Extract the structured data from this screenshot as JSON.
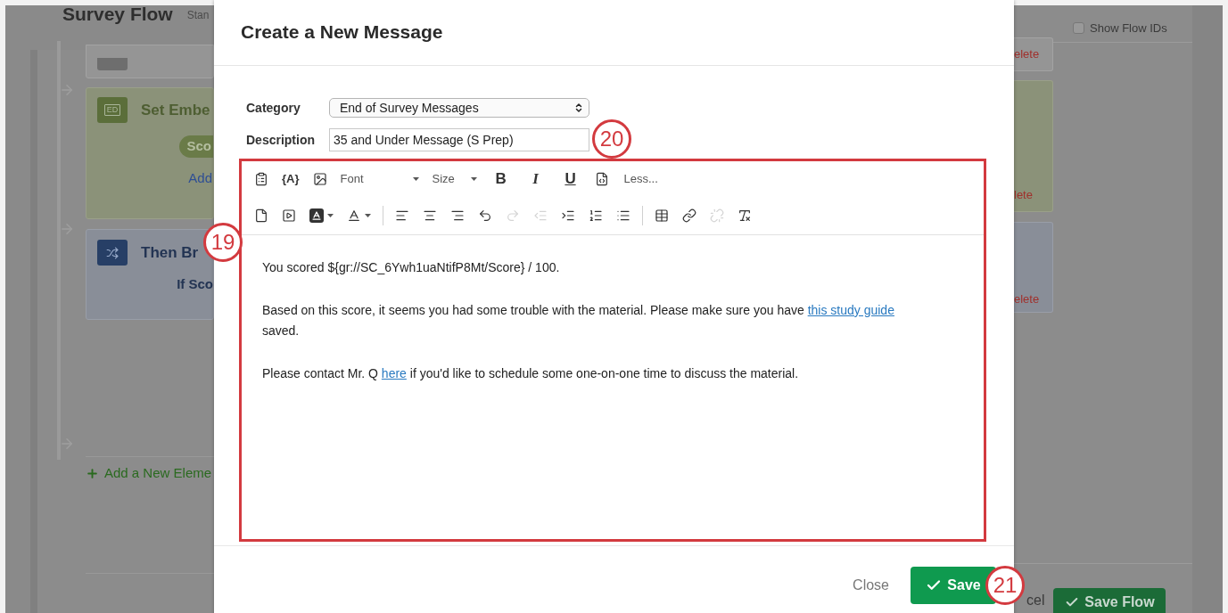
{
  "background": {
    "title": "Survey Flow",
    "subtitle": "Stan",
    "show_flow_ids": {
      "label": "Show Flow IDs",
      "checked": false
    },
    "flow_elements": [
      {
        "kind": "block",
        "delete": "elete"
      },
      {
        "kind": "embedded",
        "badge": "ED",
        "title": "Set Embe",
        "pill": "Sco",
        "link": "Add",
        "delete": "lete"
      },
      {
        "kind": "branch",
        "title": "Then Br",
        "condition": "If Sco",
        "delete": "elete"
      }
    ],
    "add_element": "Add a New Eleme",
    "cancel": "cel",
    "save_flow": "Save Flow"
  },
  "dialog": {
    "title": "Create a New Message",
    "category": {
      "label": "Category",
      "value": "End of Survey Messages"
    },
    "description": {
      "label": "Description",
      "value": "35 and Under Message (S Prep)",
      "marker": "20"
    },
    "editor": {
      "marker": "19",
      "toolbar_rows": [
        [
          {
            "kind": "icon",
            "disabled": false
          },
          {
            "kind": "glyph",
            "text": "{A}"
          },
          {
            "kind": "icon",
            "disabled": false
          },
          {
            "kind": "dropdown",
            "text": "Font"
          },
          {
            "kind": "dropdown",
            "text": "Size"
          },
          {
            "kind": "format",
            "text": "B"
          },
          {
            "kind": "format",
            "text": "I"
          },
          {
            "kind": "format",
            "text": "U"
          },
          {
            "kind": "icon",
            "disabled": false
          },
          {
            "kind": "link",
            "text": "Less..."
          }
        ],
        [
          {
            "kind": "icon",
            "disabled": false
          },
          {
            "kind": "icon",
            "disabled": false
          },
          {
            "kind": "icon_menu",
            "disabled": false
          },
          {
            "kind": "icon_menu",
            "disabled": false
          },
          {
            "kind": "separator"
          },
          {
            "kind": "icon",
            "disabled": false
          },
          {
            "kind": "icon",
            "disabled": false
          },
          {
            "kind": "icon",
            "disabled": false
          },
          {
            "kind": "icon",
            "disabled": false
          },
          {
            "kind": "icon",
            "disabled": true
          },
          {
            "kind": "icon",
            "disabled": true
          },
          {
            "kind": "icon",
            "disabled": false
          },
          {
            "kind": "icon",
            "disabled": false
          },
          {
            "kind": "icon",
            "disabled": false
          },
          {
            "kind": "separator"
          },
          {
            "kind": "icon",
            "disabled": false
          },
          {
            "kind": "icon",
            "disabled": false
          },
          {
            "kind": "icon",
            "disabled": true
          },
          {
            "kind": "icon",
            "disabled": false
          }
        ]
      ],
      "paragraphs": [
        [
          {
            "kind": "text",
            "text": "You scored ${gr://SC_6Ywh1uaNtifP8Mt/Score} / 100."
          }
        ],
        [
          {
            "kind": "text",
            "text": "Based on this score, it seems you had some trouble with the material. Please make sure you have "
          },
          {
            "kind": "link",
            "text": "this study guide"
          },
          {
            "kind": "text",
            "text": " saved."
          }
        ],
        [
          {
            "kind": "text",
            "text": "Please contact Mr. Q "
          },
          {
            "kind": "link",
            "text": "here"
          },
          {
            "kind": "text",
            "text": " if you'd like to schedule some one-on-one time to discuss the material."
          }
        ]
      ]
    },
    "close": "Close",
    "save": {
      "label": "Save",
      "marker": "21"
    }
  }
}
